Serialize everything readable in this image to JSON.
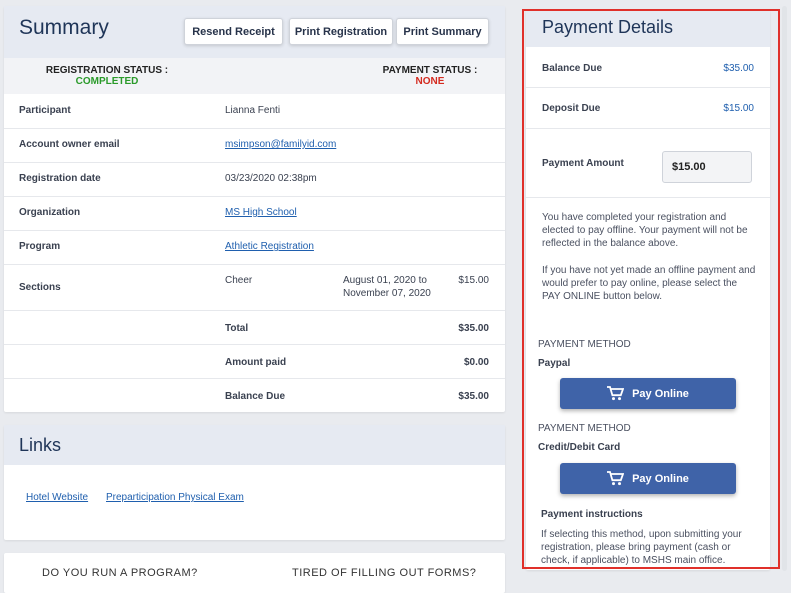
{
  "summary": {
    "title": "Summary",
    "buttons": {
      "resend": "Resend Receipt",
      "print_registration": "Print Registration",
      "print_summary": "Print Summary"
    },
    "registration_status": {
      "label": "REGISTRATION STATUS :",
      "value": "COMPLETED",
      "color": "#2a9a2a"
    },
    "payment_status": {
      "label": "PAYMENT STATUS :",
      "value": "NONE",
      "color": "#d42a1f"
    },
    "rows": {
      "participant": {
        "label": "Participant",
        "value": "Lianna Fenti"
      },
      "email": {
        "label": "Account owner email",
        "value": "msimpson@familyid.com"
      },
      "date": {
        "label": "Registration date",
        "value": "03/23/2020 02:38pm"
      },
      "organization": {
        "label": "Organization",
        "value": "MS High School"
      },
      "program": {
        "label": "Program",
        "value": "Athletic Registration"
      },
      "sections": {
        "label": "Sections",
        "name": "Cheer",
        "dates_line1": "August 01, 2020 to",
        "dates_line2": "November 07, 2020",
        "price": "$15.00"
      }
    },
    "totals": {
      "total": {
        "label": "Total",
        "value": "$35.00"
      },
      "paid": {
        "label": "Amount paid",
        "value": "$0.00"
      },
      "balance": {
        "label": "Balance Due",
        "value": "$35.00"
      }
    }
  },
  "links": {
    "title": "Links",
    "items": [
      "Hotel Website",
      "Preparticipation Physical Exam"
    ]
  },
  "promo": {
    "left": "DO YOU RUN A PROGRAM?",
    "right": "TIRED OF FILLING OUT FORMS?"
  },
  "payment": {
    "title": "Payment Details",
    "balance_due": {
      "label": "Balance Due",
      "value": "$35.00"
    },
    "deposit_due": {
      "label": "Deposit Due",
      "value": "$15.00"
    },
    "payment_amount": {
      "label": "Payment Amount",
      "value": "$15.00"
    },
    "note1": "You have completed your registration and elected to pay offline. Your payment will not be reflected in the balance above.",
    "note2": "If you have not yet made an offline payment and would prefer to pay online, please select the PAY ONLINE button below.",
    "methods": [
      {
        "heading": "PAYMENT METHOD",
        "name": "Paypal",
        "button": "Pay Online"
      },
      {
        "heading": "PAYMENT METHOD",
        "name": "Credit/Debit Card",
        "button": "Pay Online"
      }
    ],
    "instructions_title": "Payment instructions",
    "instructions": "If selecting this method, upon submitting your registration, please bring payment (cash or check, if applicable) to MSHS main office.",
    "accent": "#3f63a8"
  },
  "icons": {
    "cart": "cart-icon"
  }
}
